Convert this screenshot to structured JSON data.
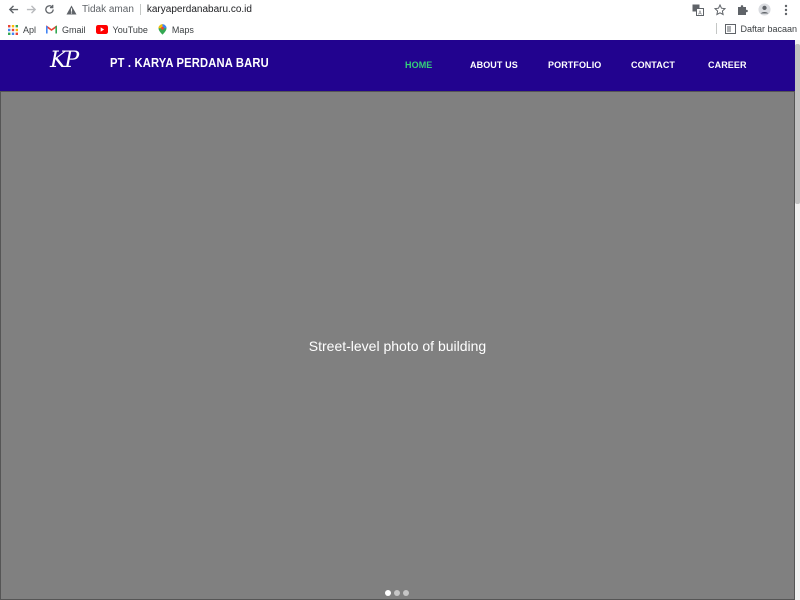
{
  "browser": {
    "security_label": "Tidak aman",
    "url": "karyaperdanabaru.co.id",
    "bookmarks": [
      {
        "label": "Apl",
        "icon": "apps-grid-icon"
      },
      {
        "label": "Gmail",
        "icon": "gmail-icon"
      },
      {
        "label": "YouTube",
        "icon": "youtube-icon"
      },
      {
        "label": "Maps",
        "icon": "maps-pin-icon"
      }
    ],
    "reading_list_label": "Daftar bacaan"
  },
  "site": {
    "logo_text": "KP",
    "company_name": "PT . KARYA PERDANA BARU",
    "nav": [
      {
        "label": "HOME",
        "active": true
      },
      {
        "label": "ABOUT US",
        "active": false
      },
      {
        "label": "PORTFOLIO",
        "active": false
      },
      {
        "label": "CONTACT",
        "active": false
      },
      {
        "label": "CAREER",
        "active": false
      }
    ],
    "colors": {
      "header_bg": "#22038f",
      "nav_active": "#35d27a",
      "nav_text": "#ffffff"
    }
  },
  "hero": {
    "image_description": "Street-level photo of building",
    "slides_total": 3,
    "active_slide": 1
  }
}
